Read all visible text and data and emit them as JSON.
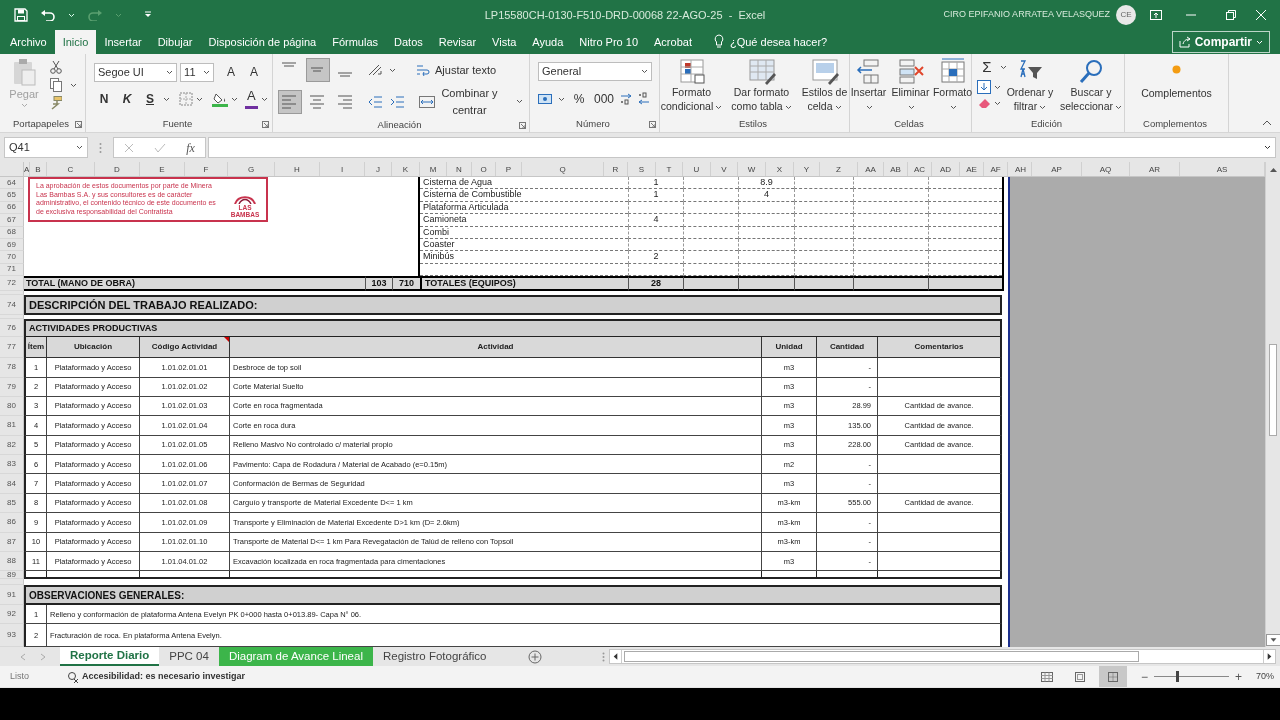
{
  "title_bar": {
    "title": "LP15580CH-0130-F510-DRD-00068 22-AGO-25  -  Excel",
    "user": "CIRO EPIFANIO ARRATEA VELASQUEZ",
    "initials": "CE"
  },
  "ribbon_tabs": [
    {
      "label": "Archivo",
      "selected": false
    },
    {
      "label": "Inicio",
      "selected": true
    },
    {
      "label": "Insertar",
      "selected": false
    },
    {
      "label": "Dibujar",
      "selected": false
    },
    {
      "label": "Disposición de página",
      "selected": false
    },
    {
      "label": "Fórmulas",
      "selected": false
    },
    {
      "label": "Datos",
      "selected": false
    },
    {
      "label": "Revisar",
      "selected": false
    },
    {
      "label": "Vista",
      "selected": false
    },
    {
      "label": "Ayuda",
      "selected": false
    },
    {
      "label": "Nitro Pro 10",
      "selected": false
    },
    {
      "label": "Acrobat",
      "selected": false
    }
  ],
  "tell_me": "¿Qué desea hacer?",
  "share": "Compartir",
  "ribbon": {
    "clipboard": {
      "paste": {
        "label": "Pegar",
        "disabled": true
      },
      "label": "Portapapeles"
    },
    "font": {
      "name": "Segoe UI",
      "size": "11",
      "grow": "A",
      "shrink": "A",
      "bold": "N",
      "italic": "K",
      "underline": "S",
      "color_letter": "A",
      "label": "Fuente"
    },
    "alignment": {
      "vertical": [
        {
          "kind": "top",
          "selected": false
        },
        {
          "kind": "middle",
          "selected": true
        },
        {
          "kind": "bottom",
          "selected": false
        }
      ],
      "horizontal": [
        {
          "kind": "left",
          "selected": true
        },
        {
          "kind": "center",
          "selected": false
        },
        {
          "kind": "right",
          "selected": false
        }
      ],
      "wrap": "Ajustar texto",
      "merge": "Combinar y centrar",
      "label": "Alineación"
    },
    "number": {
      "format": "General",
      "percent": "%",
      "thousands": "000",
      "label": "Número"
    },
    "styles": {
      "buttons": [
        "Formato condicional",
        "Dar formato como tabla",
        "Estilos de celda"
      ],
      "label": "Estilos"
    },
    "cells": {
      "buttons": [
        "Insertar",
        "Eliminar",
        "Formato"
      ],
      "label": "Celdas"
    },
    "editing": {
      "autosum": "Σ",
      "buttons": [
        "Ordenar y filtrar",
        "Buscar y seleccionar"
      ],
      "label": "Edición"
    },
    "addins": {
      "button": "Complementos",
      "label": "Complementos"
    }
  },
  "formula_bar": {
    "name_box": "Q41",
    "fx": "fx"
  },
  "columns": [
    "A",
    "B",
    "C",
    "D",
    "E",
    "F",
    "G",
    "H",
    "I",
    "J",
    "K",
    "M",
    "N",
    "O",
    "P",
    "Q",
    "R",
    "S",
    "T",
    "U",
    "V",
    "W",
    "X",
    "Y",
    "Z",
    "AA",
    "AB",
    "AC",
    "AD",
    "AE",
    "AF",
    "AH",
    "AP",
    "AQ",
    "AR",
    "AS"
  ],
  "sheet": {
    "notice": {
      "text": "La aprobación de estos documentos por parte de Minera Las Bambas S.A. y sus consultores es de carácter administrativo, el contenido técnico de este documento es de exclusiva responsabilidad del Contratista",
      "logo": "LAS BAMBAS"
    },
    "equipment": [
      {
        "row": "64",
        "name": "Cisterna de Agua",
        "qty": "1",
        "col_w": "8.9"
      },
      {
        "row": "65",
        "name": "Cisterna de Combustible",
        "qty": "1",
        "col_w": "4"
      },
      {
        "row": "66",
        "name": "Plataforma Articulada"
      },
      {
        "row": "67",
        "name": "Camioneta",
        "qty": "4"
      },
      {
        "row": "68",
        "name": "Combi"
      },
      {
        "row": "69",
        "name": "Coaster"
      },
      {
        "row": "70",
        "name": "Minibús",
        "qty": "2"
      },
      {
        "row": "71"
      }
    ],
    "totals": {
      "row": "72",
      "labor_label": "TOTAL (MANO DE OBRA)",
      "labor_1": "103",
      "labor_2": "710",
      "equipment_label": "TOTALES (EQUIPOS)",
      "equipment_total": "28"
    },
    "description": {
      "row": "74",
      "title": "DESCRIPCIÓN DEL TRABAJO REALIZADO:"
    },
    "activities": {
      "row": "76",
      "title": "ACTIVIDADES PRODUCTIVAS",
      "header_row": "77",
      "columns": [
        "Ítem",
        "Ubicación",
        "Código Actividad",
        "Actividad",
        "Unidad",
        "Cantidad",
        "Comentarios"
      ],
      "rows": [
        {
          "row": "78",
          "cells": [
            "1",
            "Plataformado y Acceso",
            "1.01.02.01.01",
            "Desbroce de top soil",
            "m3",
            "-",
            ""
          ]
        },
        {
          "row": "79",
          "cells": [
            "2",
            "Plataformado y Acceso",
            "1.01.02.01.02",
            "Corte Material Suelto",
            "m3",
            "-",
            ""
          ]
        },
        {
          "row": "80",
          "cells": [
            "3",
            "Plataformado y Acceso",
            "1.01.02.01.03",
            "Corte en roca fragmentada",
            "m3",
            "28.99",
            "Cantidad de avance."
          ]
        },
        {
          "row": "81",
          "cells": [
            "4",
            "Plataformado y Acceso",
            "1.01.02.01.04",
            "Corte en roca dura",
            "m3",
            "135.00",
            "Cantidad de avance."
          ]
        },
        {
          "row": "82",
          "cells": [
            "5",
            "Plataformado y Acceso",
            "1.01.02.01.05",
            "Relleno Masivo No controlado c/ material propio",
            "m3",
            "228.00",
            "Cantidad de avance."
          ]
        },
        {
          "row": "83",
          "cells": [
            "6",
            "Plataformado y Acceso",
            "1.01.02.01.06",
            "Pavimento: Capa de Rodadura / Material de Acabado (e=0.15m)",
            "m2",
            "-",
            ""
          ]
        },
        {
          "row": "84",
          "cells": [
            "7",
            "Plataformado y Acceso",
            "1.01.02.01.07",
            "Conformación de Bermas de Seguridad",
            "m3",
            "-",
            ""
          ]
        },
        {
          "row": "85",
          "cells": [
            "8",
            "Plataformado y Acceso",
            "1.01.02.01.08",
            "Carguío y transporte de Material Excedente D<= 1 km",
            "m3-km",
            "555.00",
            "Cantidad de avance."
          ]
        },
        {
          "row": "86",
          "cells": [
            "9",
            "Plataformado y Acceso",
            "1.01.02.01.09",
            "Transporte y Eliminación de Material Excedente D>1 km (D= 2.6km)",
            "m3-km",
            "-",
            ""
          ]
        },
        {
          "row": "87",
          "cells": [
            "10",
            "Plataformado y Acceso",
            "1.01.02.01.10",
            "Transporte de Material D<= 1 km Para Revegatación de Talúd de relleno con Topsoil",
            "m3-km",
            "-",
            ""
          ]
        },
        {
          "row": "88",
          "cells": [
            "11",
            "Plataformado y Acceso",
            "1.01.04.01.02",
            "Excavación localizada en roca fragmentada para cimentaciones",
            "m3",
            "-",
            ""
          ]
        }
      ],
      "blank_row": "89"
    },
    "observations": {
      "row": "91",
      "title": "OBSERVACIONES GENERALES:",
      "rows": [
        {
          "row": "92",
          "item": "1",
          "text": "Relleno y conformación de plataforma Antena Evelyn PK 0+000 hasta 0+013.89- Capa N° 06."
        },
        {
          "row": "93",
          "item": "2",
          "text": "Fracturación de roca. En plataforma Antena Evelyn."
        }
      ]
    }
  },
  "sheet_tabs": [
    {
      "label": "Reporte Diario",
      "selected": true
    },
    {
      "label": "PPC 04",
      "selected": false
    },
    {
      "label": "Diagram de Avance Lineal",
      "selected": false,
      "color": "#3cb54a"
    },
    {
      "label": "Registro Fotográfico",
      "selected": false
    }
  ],
  "status_bar": {
    "mode": "Listo",
    "accessibility": "Accesibilidad: es necesario investigar",
    "views": [
      {
        "kind": "normal",
        "selected": false
      },
      {
        "kind": "page_layout",
        "selected": false
      },
      {
        "kind": "page_break",
        "selected": true
      }
    ],
    "zoom_out": "−",
    "zoom_in": "+",
    "zoom_slider": {
      "level": 0.3
    },
    "zoom": "70%"
  }
}
